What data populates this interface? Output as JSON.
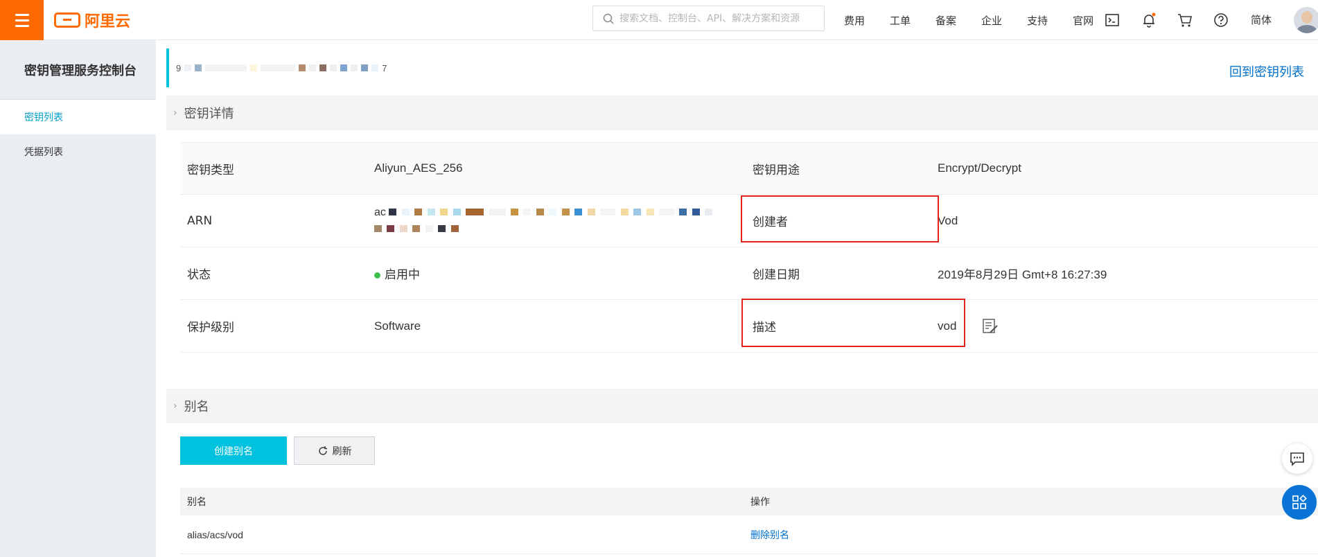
{
  "header": {
    "logo_text": "阿里云",
    "search_placeholder": "搜索文档、控制台、API、解决方案和资源",
    "nav": [
      "费用",
      "工单",
      "备案",
      "企业",
      "支持",
      "官网"
    ],
    "language": "简体",
    "icons": [
      "menu-icon",
      "search-icon",
      "terminal-icon",
      "bell-icon",
      "cart-icon",
      "help-icon"
    ],
    "accent_color": "#ff6a00"
  },
  "sidebar": {
    "title": "密钥管理服务控制台",
    "items": [
      {
        "label": "密钥列表",
        "active": true
      },
      {
        "label": "凭据列表",
        "active": false
      }
    ]
  },
  "keybar": {
    "key_id_prefix": "9",
    "key_id_suffix": "7",
    "back_link": "回到密钥列表"
  },
  "details": {
    "section_title": "密钥详情",
    "rows": [
      {
        "label": "密钥类型",
        "value": "Aliyun_AES_256",
        "label2": "密钥用途",
        "value2": "Encrypt/Decrypt"
      },
      {
        "label": "ARN",
        "value": "ac",
        "label2": "创建者",
        "value2": "Vod"
      },
      {
        "label": "状态",
        "value": "启用中",
        "label2": "创建日期",
        "value2": "2019年8月29日 Gmt+8 16:27:39"
      },
      {
        "label": "保护级别",
        "value": "Software",
        "label2": "描述",
        "value2": "vod"
      }
    ],
    "status_color": "#3fbf4f"
  },
  "alias": {
    "section_title": "别名",
    "create_button": "创建别名",
    "refresh_button": "刷新",
    "columns": [
      "别名",
      "操作"
    ],
    "rows": [
      {
        "alias": "alias/acs/vod",
        "action": "删除别名"
      }
    ]
  }
}
